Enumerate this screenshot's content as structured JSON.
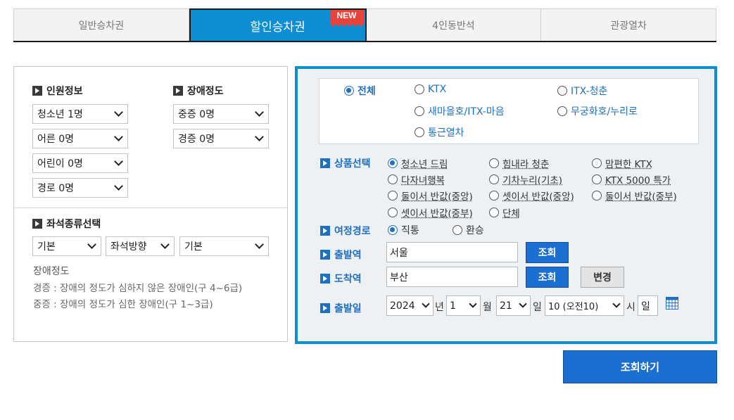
{
  "tabs": [
    {
      "label": "일반승차권",
      "active": false
    },
    {
      "label": "할인승차권",
      "active": true,
      "badge": "NEW"
    },
    {
      "label": "4인동반석",
      "active": false
    },
    {
      "label": "관광열차",
      "active": false
    }
  ],
  "left": {
    "passenger_title": "인원정보",
    "disability_title": "장애정도",
    "passengers": [
      "청소년 1명",
      "어른 0명",
      "어린이 0명",
      "경로 0명"
    ],
    "disability": [
      "중증 0명",
      "경증 0명"
    ],
    "seat_title": "좌석종류선택",
    "seat_selects": [
      "기본",
      "좌석방향",
      "기본"
    ],
    "note_title": "장애정도",
    "notes": [
      "경증 : 장애의 정도가 심하지 않은 장애인(구 4~6급)",
      "중증 : 장애의 정도가 심한 장애인(구 1~3급)"
    ]
  },
  "trains": {
    "options": [
      "전체",
      "KTX",
      "ITX-청춘",
      "새마을호/ITX-마음",
      "무궁화호/누리로",
      "통근열차"
    ],
    "selected": "전체"
  },
  "product": {
    "label": "상품선택",
    "options": [
      "청소년 드림",
      "힘내라 청춘",
      "맘편한 KTX",
      "다자녀행복",
      "기차누리(기초)",
      "KTX 5000 특가",
      "둘이서 반값(중앙)",
      "셋이서 반값(중앙)",
      "둘이서 반값(중부)",
      "셋이서 반값(중부)",
      "단체"
    ],
    "selected": "청소년 드림"
  },
  "route": {
    "label": "여정경로",
    "options": [
      "직통",
      "환승"
    ],
    "selected": "직통"
  },
  "departure": {
    "label": "출발역",
    "value": "서울",
    "button": "조회"
  },
  "arrival": {
    "label": "도착역",
    "value": "부산",
    "button": "조회",
    "swap": "변경"
  },
  "date": {
    "label": "출발일",
    "year": "2024",
    "year_unit": "년",
    "month": "1",
    "month_unit": "월",
    "day": "21",
    "day_unit": "일",
    "hour": "10 (오전10)",
    "hour_unit": "시",
    "weekday": "일"
  },
  "search_button": "조회하기",
  "colors": {
    "accent": "#0d8ed3",
    "button": "#1b6fd1",
    "badge": "#e8433a"
  }
}
